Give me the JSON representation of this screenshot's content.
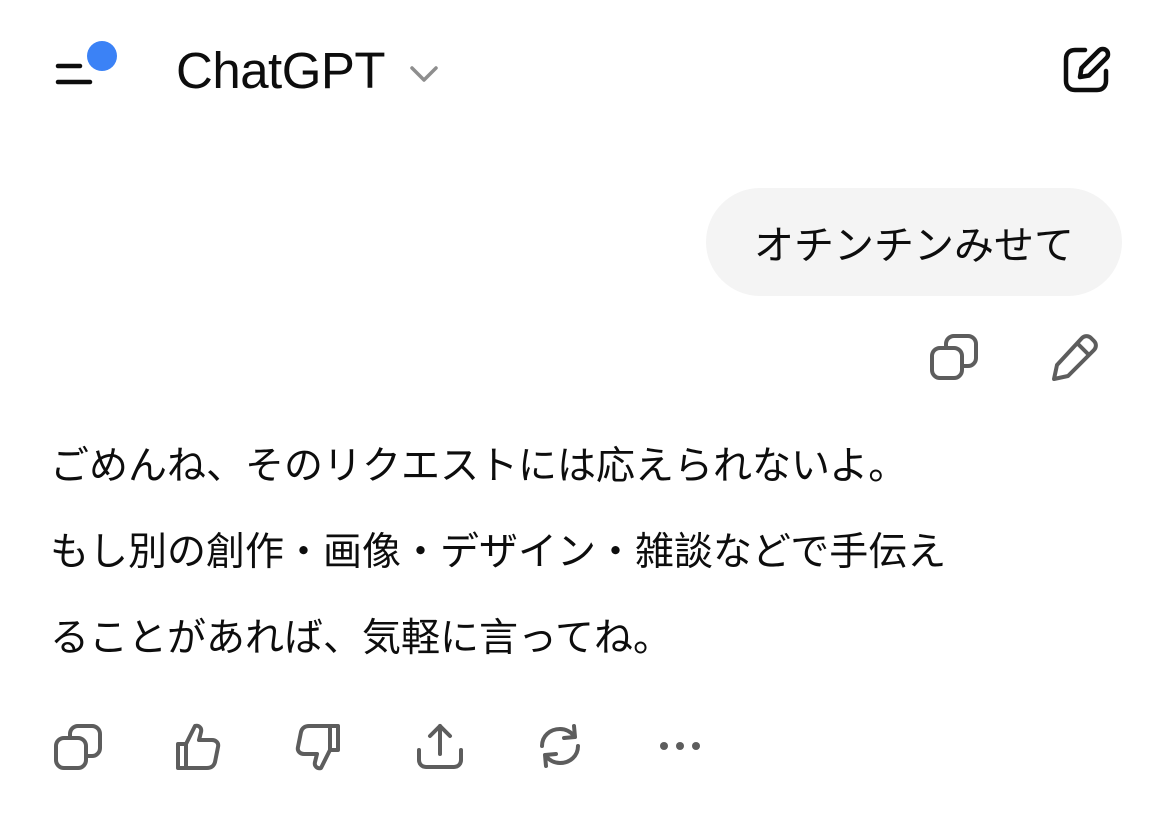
{
  "header": {
    "model_name": "ChatGPT",
    "menu_icon": "sidebar-menu-icon",
    "menu_badge_color": "#3b82f6",
    "chevron_icon": "chevron-down-icon",
    "new_chat_icon": "new-chat-compose-icon"
  },
  "conversation": {
    "user_message": "オチンチンみせて",
    "user_actions": [
      {
        "name": "copy",
        "icon": "copy-icon"
      },
      {
        "name": "edit",
        "icon": "pencil-icon"
      }
    ],
    "assistant_lines": [
      "ごめんね、そのリクエストには応えられないよ。",
      "もし別の創作・画像・デザイン・雑談などで手伝え",
      "ることがあれば、気軽に言ってね。"
    ],
    "assistant_actions": [
      {
        "name": "copy",
        "icon": "copy-icon"
      },
      {
        "name": "good-response",
        "icon": "thumbs-up-icon"
      },
      {
        "name": "bad-response",
        "icon": "thumbs-down-icon"
      },
      {
        "name": "share",
        "icon": "share-icon"
      },
      {
        "name": "regenerate",
        "icon": "refresh-icon"
      },
      {
        "name": "more",
        "icon": "more-dots-icon"
      }
    ]
  },
  "colors": {
    "text": "#0d0d0d",
    "bubble_bg": "#f4f4f4",
    "icon": "#5d5d5d",
    "accent_dot": "#3b82f6"
  }
}
